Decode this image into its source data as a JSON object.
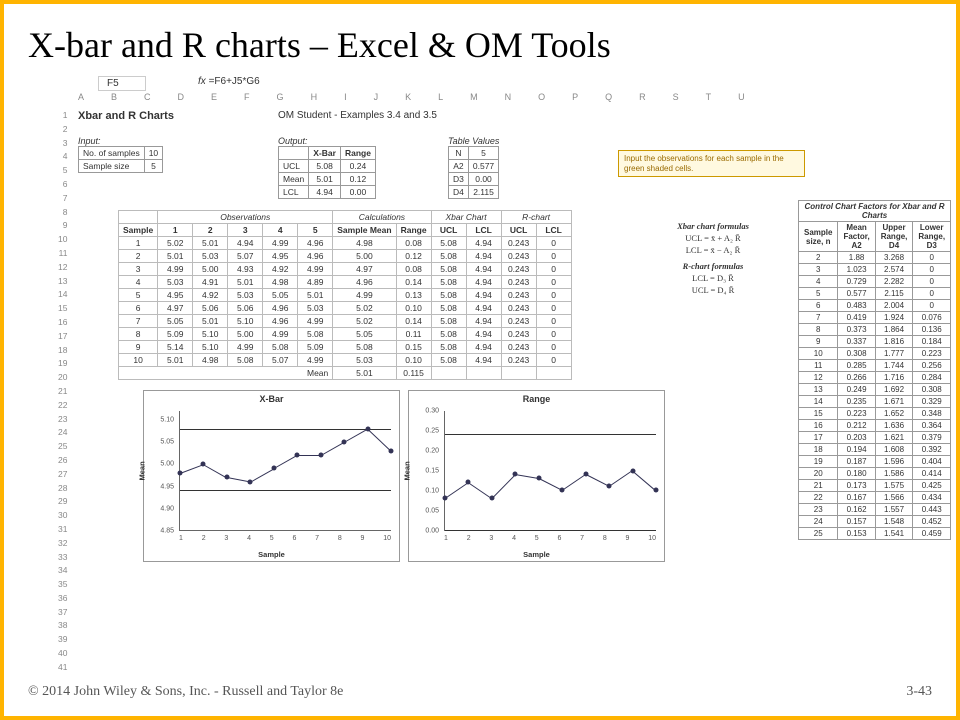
{
  "slide": {
    "title": "X-bar and R charts – Excel & OM Tools",
    "footer_left": "© 2014 John Wiley & Sons, Inc. - Russell and Taylor 8e",
    "footer_right": "3-43"
  },
  "cellref": "F5",
  "fx_label": "fx",
  "fx_formula": "=F6+J5*G6",
  "col_headers": [
    "A",
    "B",
    "C",
    "D",
    "E",
    "F",
    "G",
    "H",
    "I",
    "J",
    "K",
    "L",
    "M",
    "N",
    "O",
    "P",
    "Q",
    "R",
    "S",
    "T",
    "U"
  ],
  "row_numbers": [
    "1",
    "2",
    "3",
    "4",
    "5",
    "6",
    "7",
    "8",
    "9",
    "10",
    "11",
    "12",
    "13",
    "14",
    "15",
    "16",
    "17",
    "18",
    "19",
    "20",
    "21",
    "22",
    "23",
    "24",
    "25",
    "26",
    "27",
    "28",
    "29",
    "30",
    "31",
    "32",
    "33",
    "34",
    "35",
    "36",
    "37",
    "38",
    "39",
    "40",
    "41"
  ],
  "sheet_title": "Xbar and R Charts",
  "example_label": "OM Student - Examples 3.4 and 3.5",
  "input": {
    "heading": "Input:",
    "rows": [
      {
        "label": "No. of samples",
        "value": "10"
      },
      {
        "label": "Sample size",
        "value": "5"
      }
    ]
  },
  "output": {
    "heading": "Output:",
    "cols": [
      "",
      "X-Bar",
      "Range"
    ],
    "rows": [
      [
        "UCL",
        "5.08",
        "0.24"
      ],
      [
        "Mean",
        "5.01",
        "0.12"
      ],
      [
        "LCL",
        "4.94",
        "0.00"
      ]
    ]
  },
  "table_values": {
    "heading": "Table Values",
    "rows": [
      [
        "N",
        "5"
      ],
      [
        "A2",
        "0.577"
      ],
      [
        "D3",
        "0.00"
      ],
      [
        "D4",
        "2.115"
      ]
    ]
  },
  "note_text": "Input the observations for each sample in the green shaded cells.",
  "main_table": {
    "section_headers": [
      "Observations",
      "Calculations",
      "Xbar Chart",
      "R-chart"
    ],
    "cols": [
      "Sample",
      "1",
      "2",
      "3",
      "4",
      "5",
      "Sample Mean",
      "Range",
      "UCL",
      "LCL",
      "UCL",
      "LCL"
    ],
    "rows": [
      [
        "1",
        "5.02",
        "5.01",
        "4.94",
        "4.99",
        "4.96",
        "4.98",
        "0.08",
        "5.08",
        "4.94",
        "0.243",
        "0"
      ],
      [
        "2",
        "5.01",
        "5.03",
        "5.07",
        "4.95",
        "4.96",
        "5.00",
        "0.12",
        "5.08",
        "4.94",
        "0.243",
        "0"
      ],
      [
        "3",
        "4.99",
        "5.00",
        "4.93",
        "4.92",
        "4.99",
        "4.97",
        "0.08",
        "5.08",
        "4.94",
        "0.243",
        "0"
      ],
      [
        "4",
        "5.03",
        "4.91",
        "5.01",
        "4.98",
        "4.89",
        "4.96",
        "0.14",
        "5.08",
        "4.94",
        "0.243",
        "0"
      ],
      [
        "5",
        "4.95",
        "4.92",
        "5.03",
        "5.05",
        "5.01",
        "4.99",
        "0.13",
        "5.08",
        "4.94",
        "0.243",
        "0"
      ],
      [
        "6",
        "4.97",
        "5.06",
        "5.06",
        "4.96",
        "5.03",
        "5.02",
        "0.10",
        "5.08",
        "4.94",
        "0.243",
        "0"
      ],
      [
        "7",
        "5.05",
        "5.01",
        "5.10",
        "4.96",
        "4.99",
        "5.02",
        "0.14",
        "5.08",
        "4.94",
        "0.243",
        "0"
      ],
      [
        "8",
        "5.09",
        "5.10",
        "5.00",
        "4.99",
        "5.08",
        "5.05",
        "0.11",
        "5.08",
        "4.94",
        "0.243",
        "0"
      ],
      [
        "9",
        "5.14",
        "5.10",
        "4.99",
        "5.08",
        "5.09",
        "5.08",
        "0.15",
        "5.08",
        "4.94",
        "0.243",
        "0"
      ],
      [
        "10",
        "5.01",
        "4.98",
        "5.08",
        "5.07",
        "4.99",
        "5.03",
        "0.10",
        "5.08",
        "4.94",
        "0.243",
        "0"
      ]
    ],
    "footer": [
      "Mean",
      "5.01",
      "0.115"
    ]
  },
  "formulas": {
    "xbar_title": "Xbar chart formulas",
    "xbar_ucl": "UCL = x̄ + A₂ R̄",
    "xbar_lcl": "LCL = x̄ − A₂ R̄",
    "r_title": "R-chart formulas",
    "r_lcl": "LCL = D₃ R̄",
    "r_ucl": "UCL = D₄ R̄"
  },
  "factors": {
    "title": "Control Chart Factors for Xbar and R Charts",
    "cols": [
      "Sample size, n",
      "Mean Factor, A2",
      "Upper Range, D4",
      "Lower Range, D3"
    ],
    "rows": [
      [
        "2",
        "1.88",
        "3.268",
        "0"
      ],
      [
        "3",
        "1.023",
        "2.574",
        "0"
      ],
      [
        "4",
        "0.729",
        "2.282",
        "0"
      ],
      [
        "5",
        "0.577",
        "2.115",
        "0"
      ],
      [
        "6",
        "0.483",
        "2.004",
        "0"
      ],
      [
        "7",
        "0.419",
        "1.924",
        "0.076"
      ],
      [
        "8",
        "0.373",
        "1.864",
        "0.136"
      ],
      [
        "9",
        "0.337",
        "1.816",
        "0.184"
      ],
      [
        "10",
        "0.308",
        "1.777",
        "0.223"
      ],
      [
        "11",
        "0.285",
        "1.744",
        "0.256"
      ],
      [
        "12",
        "0.266",
        "1.716",
        "0.284"
      ],
      [
        "13",
        "0.249",
        "1.692",
        "0.308"
      ],
      [
        "14",
        "0.235",
        "1.671",
        "0.329"
      ],
      [
        "15",
        "0.223",
        "1.652",
        "0.348"
      ],
      [
        "16",
        "0.212",
        "1.636",
        "0.364"
      ],
      [
        "17",
        "0.203",
        "1.621",
        "0.379"
      ],
      [
        "18",
        "0.194",
        "1.608",
        "0.392"
      ],
      [
        "19",
        "0.187",
        "1.596",
        "0.404"
      ],
      [
        "20",
        "0.180",
        "1.586",
        "0.414"
      ],
      [
        "21",
        "0.173",
        "1.575",
        "0.425"
      ],
      [
        "22",
        "0.167",
        "1.566",
        "0.434"
      ],
      [
        "23",
        "0.162",
        "1.557",
        "0.443"
      ],
      [
        "24",
        "0.157",
        "1.548",
        "0.452"
      ],
      [
        "25",
        "0.153",
        "1.541",
        "0.459"
      ]
    ]
  },
  "chart_data": [
    {
      "type": "line",
      "title": "X-Bar",
      "xlabel": "Sample",
      "ylabel": "Mean",
      "x": [
        1,
        2,
        3,
        4,
        5,
        6,
        7,
        8,
        9,
        10
      ],
      "values": [
        4.98,
        5.0,
        4.97,
        4.96,
        4.99,
        5.02,
        5.02,
        5.05,
        5.08,
        5.03
      ],
      "ylim": [
        4.85,
        5.12
      ],
      "yticks": [
        4.85,
        4.9,
        4.95,
        5.0,
        5.05,
        5.1
      ],
      "ucl": 5.08,
      "lcl": 4.94
    },
    {
      "type": "line",
      "title": "Range",
      "xlabel": "Sample",
      "ylabel": "Mean",
      "x": [
        1,
        2,
        3,
        4,
        5,
        6,
        7,
        8,
        9,
        10
      ],
      "values": [
        0.08,
        0.12,
        0.08,
        0.14,
        0.13,
        0.1,
        0.14,
        0.11,
        0.15,
        0.1
      ],
      "ylim": [
        0.0,
        0.3
      ],
      "yticks": [
        0.0,
        0.05,
        0.1,
        0.15,
        0.2,
        0.25,
        0.3
      ],
      "ucl": 0.243,
      "lcl": 0.0
    }
  ]
}
